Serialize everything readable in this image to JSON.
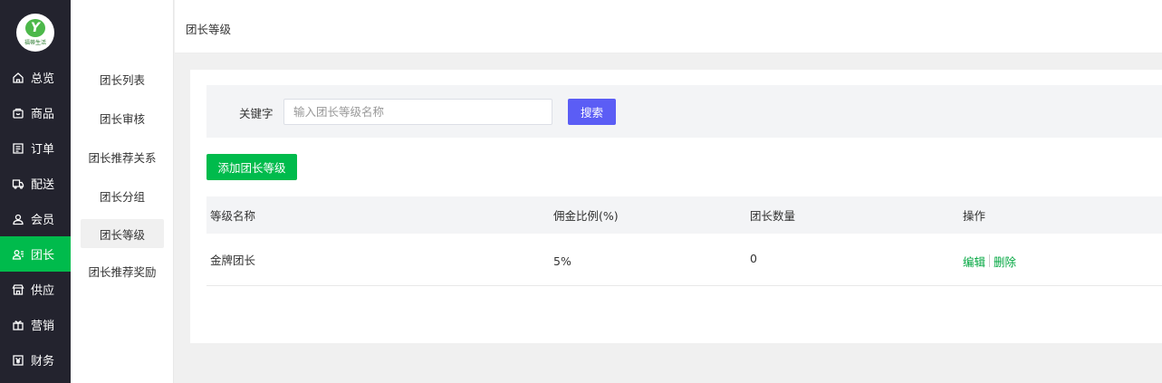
{
  "brand": {
    "logo_text": "福蒂生活",
    "logo_mark": "Y",
    "accent": "#00bb4c",
    "primary_button": "#5b5df5"
  },
  "nav": {
    "items": [
      {
        "label": "总览",
        "icon": "home-icon",
        "active": false
      },
      {
        "label": "商品",
        "icon": "goods-icon",
        "active": false
      },
      {
        "label": "订单",
        "icon": "order-icon",
        "active": false
      },
      {
        "label": "配送",
        "icon": "delivery-icon",
        "active": false
      },
      {
        "label": "会员",
        "icon": "member-icon",
        "active": false
      },
      {
        "label": "团长",
        "icon": "leader-icon",
        "active": true
      },
      {
        "label": "供应",
        "icon": "supply-icon",
        "active": false
      },
      {
        "label": "营销",
        "icon": "gift-icon",
        "active": false
      },
      {
        "label": "财务",
        "icon": "finance-icon",
        "active": false
      }
    ]
  },
  "subnav": {
    "items": [
      {
        "label": "团长列表",
        "active": false
      },
      {
        "label": "团长审核",
        "active": false
      },
      {
        "label": "团长推荐关系",
        "active": false
      },
      {
        "label": "团长分组",
        "active": false
      },
      {
        "label": "团长等级",
        "active": true
      },
      {
        "label": "团长推荐奖励",
        "active": false
      }
    ]
  },
  "header": {
    "breadcrumb": "团长等级"
  },
  "filter": {
    "keyword_label": "关键字",
    "keyword_placeholder": "输入团长等级名称",
    "keyword_value": "",
    "search_label": "搜索"
  },
  "toolbar": {
    "add_label": "添加团长等级"
  },
  "table": {
    "columns": [
      "等级名称",
      "佣金比例(%)",
      "团长数量",
      "操作"
    ],
    "rows": [
      {
        "name": "金牌团长",
        "rate": "5%",
        "count": "0",
        "actions": [
          "编辑",
          "删除"
        ]
      }
    ]
  }
}
